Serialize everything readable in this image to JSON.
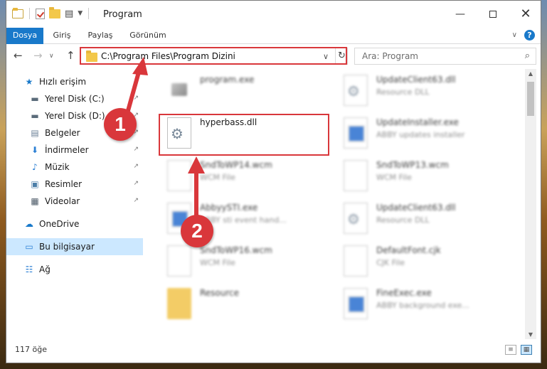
{
  "window": {
    "title": "Program",
    "controls": {
      "minimize": "—",
      "close": "✕"
    }
  },
  "ribbon": {
    "tabs": [
      {
        "label": "Dosya",
        "active": true
      },
      {
        "label": "Giriş"
      },
      {
        "label": "Paylaş"
      },
      {
        "label": "Görünüm"
      }
    ],
    "help": "?"
  },
  "nav": {
    "back": "←",
    "forward": "→",
    "recent": "∨",
    "up": "↑",
    "address": "C:\\Program Files\\Program Dizini",
    "address_dropdown": "∨",
    "refresh": "↻",
    "search_placeholder": "Ara: Program",
    "search_icon": "⌕"
  },
  "sidebar": {
    "items": [
      {
        "label": "Hızlı erişim",
        "icon": "star-icon",
        "glyph": "★",
        "pinned": false
      },
      {
        "label": "Yerel Disk (C:)",
        "icon": "drive-icon",
        "glyph": "▬",
        "pinned": true
      },
      {
        "label": "Yerel Disk (D:)",
        "icon": "drive-icon",
        "glyph": "▬",
        "pinned": true
      },
      {
        "label": "Belgeler",
        "icon": "documents-icon",
        "glyph": "▤",
        "pinned": true
      },
      {
        "label": "İndirmeler",
        "icon": "download-icon",
        "glyph": "⬇",
        "pinned": true
      },
      {
        "label": "Müzik",
        "icon": "music-icon",
        "glyph": "♪",
        "pinned": true
      },
      {
        "label": "Resimler",
        "icon": "pictures-icon",
        "glyph": "▣",
        "pinned": true
      },
      {
        "label": "Videolar",
        "icon": "videos-icon",
        "glyph": "▦",
        "pinned": true
      },
      {
        "label": "OneDrive",
        "icon": "cloud-icon",
        "glyph": "☁",
        "pinned": false
      },
      {
        "label": "Bu bilgisayar",
        "icon": "computer-icon",
        "glyph": "▭",
        "pinned": false,
        "selected": true
      },
      {
        "label": "Ağ",
        "icon": "network-icon",
        "glyph": "☷",
        "pinned": false
      }
    ],
    "pin_glyph": "↗"
  },
  "files": [
    {
      "name": "program.exe",
      "desc": "",
      "icon": "exe-icon",
      "blurred": true
    },
    {
      "name": "UpdateClient63.dll",
      "desc": "Resource DLL",
      "icon": "dll-icon",
      "blurred": true
    },
    {
      "name": "hyperbass.dll",
      "desc": "",
      "icon": "dll-icon",
      "blurred": false
    },
    {
      "name": "UpdateInstaller.exe",
      "desc": "ABBY updates installer",
      "icon": "app-icon",
      "blurred": true
    },
    {
      "name": "SndToWP14.wcm",
      "desc": "WCM File",
      "icon": "file-icon",
      "blurred": true
    },
    {
      "name": "SndToWP13.wcm",
      "desc": "WCM File",
      "icon": "file-icon",
      "blurred": true
    },
    {
      "name": "AbbyySTI.exe",
      "desc": "ABBY sti event hand...",
      "icon": "app-icon",
      "blurred": true
    },
    {
      "name": "UpdateClient63.dll",
      "desc": "Resource DLL",
      "icon": "dll-icon",
      "blurred": true
    },
    {
      "name": "SndToWP16.wcm",
      "desc": "WCM File",
      "icon": "file-icon",
      "blurred": true
    },
    {
      "name": "DefaultFont.cjk",
      "desc": "CJK File",
      "icon": "file-icon",
      "blurred": true
    },
    {
      "name": "Resource",
      "desc": "",
      "icon": "folder-icon",
      "blurred": true
    },
    {
      "name": "FineExec.exe",
      "desc": "ABBY background exe...",
      "icon": "app-icon",
      "blurred": true
    }
  ],
  "status": {
    "count": "117 öğe"
  },
  "annotations": {
    "badge1": "1",
    "badge2": "2",
    "color": "#d9373b"
  },
  "colors": {
    "accent": "#1979ca",
    "selection": "#cce8ff",
    "highlight": "#d9373b"
  }
}
